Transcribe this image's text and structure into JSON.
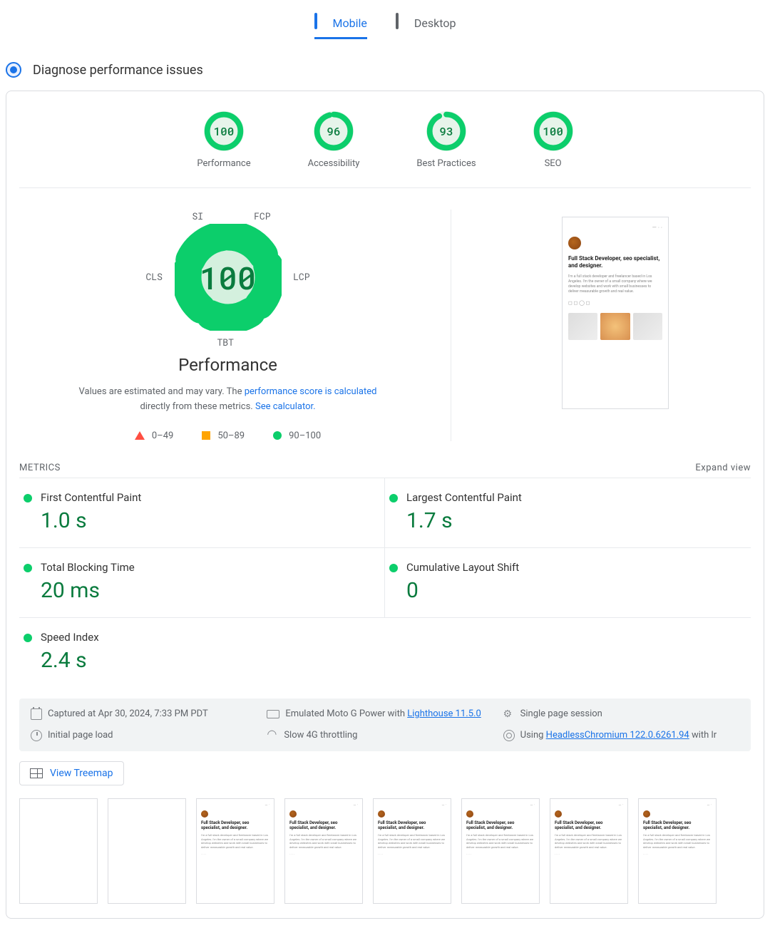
{
  "tabs": {
    "mobile": "Mobile",
    "desktop": "Desktop"
  },
  "diagnose": {
    "label": "Diagnose performance issues"
  },
  "scores": [
    {
      "value": "100",
      "label": "Performance",
      "pct": 100
    },
    {
      "value": "96",
      "label": "Accessibility",
      "pct": 96
    },
    {
      "value": "93",
      "label": "Best Practices",
      "pct": 93
    },
    {
      "value": "100",
      "label": "SEO",
      "pct": 100
    }
  ],
  "gauge": {
    "score": "100",
    "title": "Performance",
    "segments": {
      "si": "SI",
      "fcp": "FCP",
      "lcp": "LCP",
      "tbt": "TBT",
      "cls": "CLS"
    },
    "note_pre": "Values are estimated and may vary. The ",
    "note_link1": "performance score is calculated",
    "note_mid": " directly from these metrics. ",
    "note_link2": "See calculator."
  },
  "scale": {
    "r1": "0–49",
    "r2": "50–89",
    "r3": "90–100"
  },
  "preview": {
    "headline": "Full Stack Developer, seo specialist, and designer.",
    "body": "I'm a full stack developer and freelancer based in Los Angeles. I'm the owner of a small company where we develop websites and work with small businesses to deliver measurable growth and real value."
  },
  "metrics_header": {
    "title": "METRICS",
    "expand": "Expand view"
  },
  "metrics": {
    "fcp": {
      "name": "First Contentful Paint",
      "value": "1.0 s"
    },
    "lcp": {
      "name": "Largest Contentful Paint",
      "value": "1.7 s"
    },
    "tbt": {
      "name": "Total Blocking Time",
      "value": "20 ms"
    },
    "cls": {
      "name": "Cumulative Layout Shift",
      "value": "0"
    },
    "si": {
      "name": "Speed Index",
      "value": "2.4 s"
    }
  },
  "meta": {
    "captured": "Captured at Apr 30, 2024, 7:33 PM PDT",
    "device_pre": "Emulated Moto G Power with ",
    "device_link": "Lighthouse 11.5.0",
    "session": "Single page session",
    "load": "Initial page load",
    "throttle": "Slow 4G throttling",
    "browser_pre": "Using ",
    "browser_link": "HeadlessChromium 122.0.6261.94",
    "browser_post": " with lr"
  },
  "treemap": {
    "label": "View Treemap"
  }
}
